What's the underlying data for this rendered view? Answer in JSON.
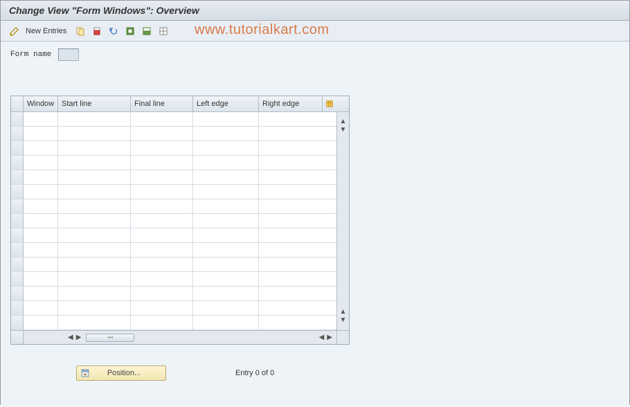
{
  "title": "Change View \"Form Windows\": Overview",
  "toolbar": {
    "new_entries_label": "New Entries"
  },
  "watermark": "www.tutorialkart.com",
  "form": {
    "name_label": "Form name",
    "name_value": ""
  },
  "table": {
    "columns": {
      "window": "Window",
      "start_line": "Start line",
      "final_line": "Final line",
      "left_edge": "Left edge",
      "right_edge": "Right edge"
    },
    "rows": []
  },
  "footer": {
    "position_label": "Position...",
    "entry_status": "Entry 0 of 0"
  }
}
